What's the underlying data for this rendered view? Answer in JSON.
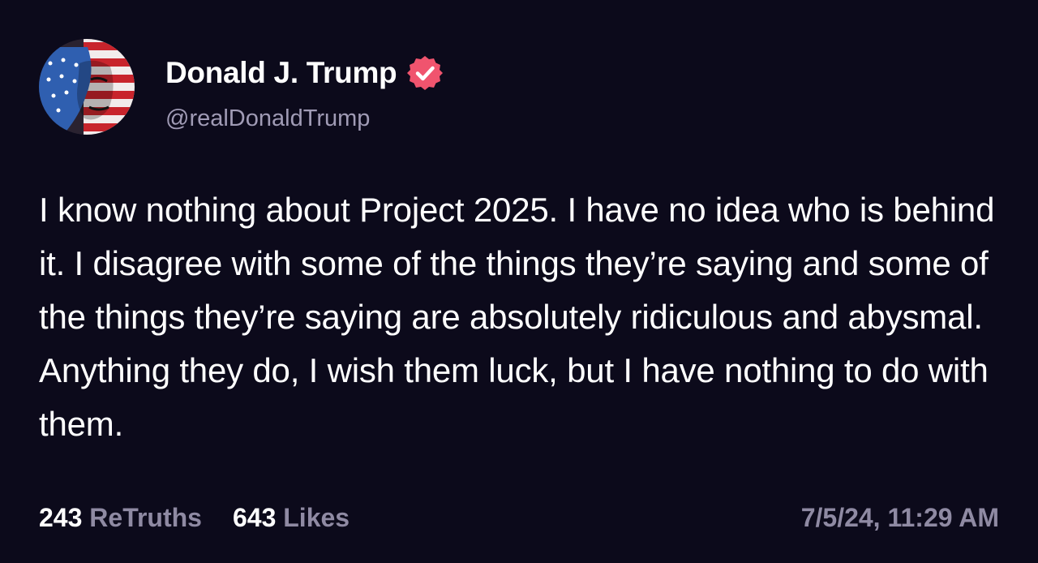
{
  "author": {
    "display_name": "Donald J. Trump",
    "handle": "@realDonaldTrump",
    "verified": true,
    "avatar_icon": "flag-face-avatar"
  },
  "post": {
    "text": "I know nothing about Project 2025. I have no idea who is behind it. I disagree with some of the things they’re saying and some of the things they’re saying are absolutely ridiculous and abysmal. Anything they do, I wish them luck, but I have nothing to do with them."
  },
  "stats": {
    "retruths_count": "243",
    "retruths_label": "ReTruths",
    "likes_count": "643",
    "likes_label": "Likes"
  },
  "timestamp": "7/5/24, 11:29 AM",
  "colors": {
    "background": "#0c0a1b",
    "verified_badge": "#f0546e",
    "muted_text": "#8f8aa3"
  }
}
